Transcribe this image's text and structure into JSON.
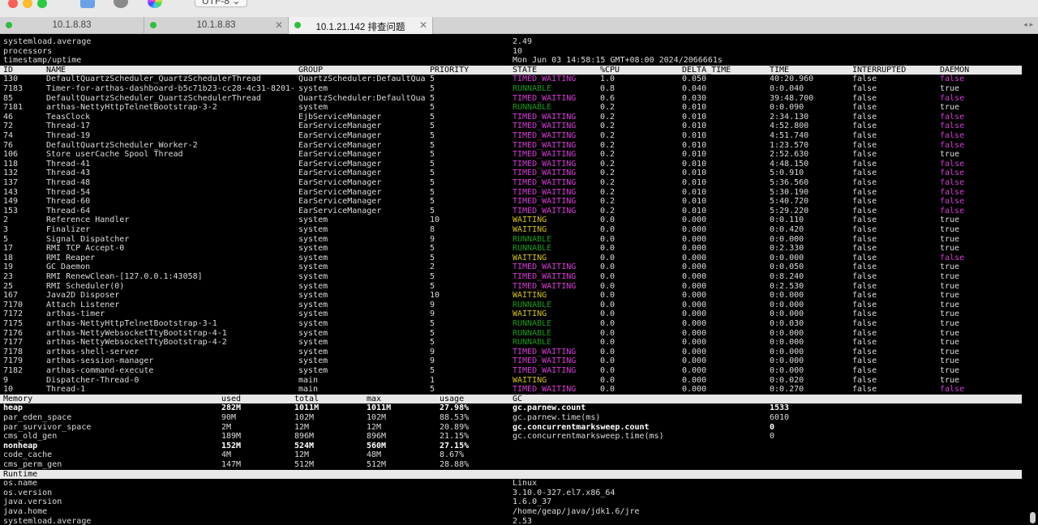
{
  "window": {
    "encoding": "UTF-8 ⌄",
    "traffic_lights": [
      "#fc5f57",
      "#fdbc2e",
      "#29c940"
    ],
    "tabs": [
      {
        "label": "10.1.8.83",
        "active": false
      },
      {
        "label": "10.1.8.83",
        "active": false
      },
      {
        "label": "10.1.21.142 排查问题",
        "active": true
      }
    ],
    "tab_close": "✕",
    "tab_nav": "◂ ▸"
  },
  "colors": {
    "timed_waiting": "#d63cd6",
    "waiting": "#d4c41c",
    "runnable": "#1f9a1f",
    "daemon_false": "#d63cd6"
  },
  "top_info": [
    {
      "key": "systemload.average",
      "value": "2.49"
    },
    {
      "key": "processors",
      "value": "10"
    },
    {
      "key": "timestamp/uptime",
      "value": "Mon Jun 03 14:58:15 GMT+08:00 2024/2066661s"
    }
  ],
  "threads": {
    "columns": [
      "ID",
      "NAME",
      "GROUP",
      "PRIORITY",
      "STATE",
      "%CPU",
      "DELTA_TIME",
      "TIME",
      "INTERRUPTED",
      "DAEMON"
    ],
    "rows": [
      [
        "130",
        "DefaultQuartzScheduler_QuartzSchedulerThread",
        "QuartzScheduler:DefaultQua",
        "5",
        "TIMED_WAITING",
        "1.0",
        "0.050",
        "40:20.960",
        "false",
        "false"
      ],
      [
        "7183",
        "Timer-for-arthas-dashboard-b5c71b23-cc28-4c31-8201-",
        "system",
        "5",
        "RUNNABLE",
        "0.8",
        "0.040",
        "0:0.040",
        "false",
        "true"
      ],
      [
        "85",
        "DefaultQuartzScheduler_QuartzSchedulerThread",
        "QuartzScheduler:DefaultQua",
        "5",
        "TIMED_WAITING",
        "0.6",
        "0.030",
        "39:48.700",
        "false",
        "false"
      ],
      [
        "7181",
        "arthas-NettyHttpTelnetBootstrap-3-2",
        "system",
        "5",
        "RUNNABLE",
        "0.2",
        "0.010",
        "0:0.090",
        "false",
        "true"
      ],
      [
        "46",
        "TeasClock",
        "EjbServiceManager",
        "5",
        "TIMED_WAITING",
        "0.2",
        "0.010",
        "2:34.130",
        "false",
        "false"
      ],
      [
        "72",
        "Thread-17",
        "EarServiceManager",
        "5",
        "TIMED_WAITING",
        "0.2",
        "0.010",
        "4:52.800",
        "false",
        "false"
      ],
      [
        "74",
        "Thread-19",
        "EarServiceManager",
        "5",
        "TIMED_WAITING",
        "0.2",
        "0.010",
        "4:51.740",
        "false",
        "false"
      ],
      [
        "76",
        "DefaultQuartzScheduler_Worker-2",
        "EarServiceManager",
        "5",
        "TIMED_WAITING",
        "0.2",
        "0.010",
        "1:23.570",
        "false",
        "false"
      ],
      [
        "106",
        "Store userCache Spool Thread",
        "EarServiceManager",
        "5",
        "TIMED_WAITING",
        "0.2",
        "0.010",
        "2:52.630",
        "false",
        "true"
      ],
      [
        "118",
        "Thread-41",
        "EarServiceManager",
        "5",
        "TIMED_WAITING",
        "0.2",
        "0.010",
        "4:48.150",
        "false",
        "false"
      ],
      [
        "132",
        "Thread-43",
        "EarServiceManager",
        "5",
        "TIMED_WAITING",
        "0.2",
        "0.010",
        "5:0.910",
        "false",
        "false"
      ],
      [
        "137",
        "Thread-48",
        "EarServiceManager",
        "5",
        "TIMED_WAITING",
        "0.2",
        "0.010",
        "5:36.560",
        "false",
        "false"
      ],
      [
        "143",
        "Thread-54",
        "EarServiceManager",
        "5",
        "TIMED_WAITING",
        "0.2",
        "0.010",
        "5:30.190",
        "false",
        "false"
      ],
      [
        "149",
        "Thread-60",
        "EarServiceManager",
        "5",
        "TIMED_WAITING",
        "0.2",
        "0.010",
        "5:40.720",
        "false",
        "false"
      ],
      [
        "153",
        "Thread-64",
        "EarServiceManager",
        "5",
        "TIMED_WAITING",
        "0.2",
        "0.010",
        "5:29.220",
        "false",
        "false"
      ],
      [
        "2",
        "Reference Handler",
        "system",
        "10",
        "WAITING",
        "0.0",
        "0.000",
        "0:0.110",
        "false",
        "true"
      ],
      [
        "3",
        "Finalizer",
        "system",
        "8",
        "WAITING",
        "0.0",
        "0.000",
        "0:0.420",
        "false",
        "true"
      ],
      [
        "5",
        "Signal Dispatcher",
        "system",
        "9",
        "RUNNABLE",
        "0.0",
        "0.000",
        "0:0.000",
        "false",
        "true"
      ],
      [
        "17",
        "RMI TCP Accept-0",
        "system",
        "5",
        "RUNNABLE",
        "0.0",
        "0.000",
        "0:2.330",
        "false",
        "true"
      ],
      [
        "18",
        "RMI Reaper",
        "system",
        "5",
        "WAITING",
        "0.0",
        "0.000",
        "0:0.000",
        "false",
        "false"
      ],
      [
        "19",
        "GC Daemon",
        "system",
        "2",
        "TIMED_WAITING",
        "0.0",
        "0.000",
        "0:0.050",
        "false",
        "true"
      ],
      [
        "23",
        "RMI RenewClean-[127.0.0.1:43058]",
        "system",
        "5",
        "TIMED_WAITING",
        "0.0",
        "0.000",
        "0:8.240",
        "false",
        "true"
      ],
      [
        "25",
        "RMI Scheduler(0)",
        "system",
        "5",
        "TIMED_WAITING",
        "0.0",
        "0.000",
        "0:2.530",
        "false",
        "true"
      ],
      [
        "167",
        "Java2D Disposer",
        "system",
        "10",
        "WAITING",
        "0.0",
        "0.000",
        "0:0.000",
        "false",
        "true"
      ],
      [
        "7170",
        "Attach Listener",
        "system",
        "9",
        "RUNNABLE",
        "0.0",
        "0.000",
        "0:0.000",
        "false",
        "true"
      ],
      [
        "7172",
        "arthas-timer",
        "system",
        "9",
        "WAITING",
        "0.0",
        "0.000",
        "0:0.000",
        "false",
        "true"
      ],
      [
        "7175",
        "arthas-NettyHttpTelnetBootstrap-3-1",
        "system",
        "5",
        "RUNNABLE",
        "0.0",
        "0.000",
        "0:0.030",
        "false",
        "true"
      ],
      [
        "7176",
        "arthas-NettyWebsocketTtyBootstrap-4-1",
        "system",
        "5",
        "RUNNABLE",
        "0.0",
        "0.000",
        "0:0.000",
        "false",
        "true"
      ],
      [
        "7177",
        "arthas-NettyWebsocketTtyBootstrap-4-2",
        "system",
        "5",
        "RUNNABLE",
        "0.0",
        "0.000",
        "0:0.000",
        "false",
        "true"
      ],
      [
        "7178",
        "arthas-shell-server",
        "system",
        "9",
        "TIMED_WAITING",
        "0.0",
        "0.000",
        "0:0.000",
        "false",
        "true"
      ],
      [
        "7179",
        "arthas-session-manager",
        "system",
        "9",
        "TIMED_WAITING",
        "0.0",
        "0.000",
        "0:0.000",
        "false",
        "true"
      ],
      [
        "7182",
        "arthas-command-execute",
        "system",
        "5",
        "TIMED_WAITING",
        "0.0",
        "0.000",
        "0:0.000",
        "false",
        "true"
      ],
      [
        "9",
        "Dispatcher-Thread-0",
        "main",
        "1",
        "WAITING",
        "0.0",
        "0.000",
        "0:0.020",
        "false",
        "true"
      ],
      [
        "10",
        "Thread-1",
        "main",
        "5",
        "TIMED_WAITING",
        "0.0",
        "0.000",
        "0:0.270",
        "false",
        "false"
      ]
    ]
  },
  "memory": {
    "columns": [
      "Memory",
      "used",
      "total",
      "max",
      "usage"
    ],
    "rows": [
      {
        "cells": [
          "heap",
          "282M",
          "1011M",
          "1011M",
          "27.98%"
        ],
        "bold": true
      },
      {
        "cells": [
          "par_eden_space",
          "90M",
          "102M",
          "102M",
          "88.53%"
        ],
        "bold": false
      },
      {
        "cells": [
          "par_survivor_space",
          "2M",
          "12M",
          "12M",
          "20.89%"
        ],
        "bold": false
      },
      {
        "cells": [
          "cms_old_gen",
          "189M",
          "896M",
          "896M",
          "21.15%"
        ],
        "bold": false
      },
      {
        "cells": [
          "nonheap",
          "152M",
          "524M",
          "560M",
          "27.15%"
        ],
        "bold": true
      },
      {
        "cells": [
          "code_cache",
          "4M",
          "12M",
          "48M",
          "8.67%"
        ],
        "bold": false
      },
      {
        "cells": [
          "cms_perm_gen",
          "147M",
          "512M",
          "512M",
          "28.88%"
        ],
        "bold": false
      }
    ]
  },
  "gc": {
    "title": "GC",
    "rows": [
      {
        "key": "gc.parnew.count",
        "value": "1533",
        "bold": true
      },
      {
        "key": "gc.parnew.time(ms)",
        "value": "6010",
        "bold": false
      },
      {
        "key": "gc.concurrentmarksweep.count",
        "value": "0",
        "bold": true
      },
      {
        "key": "gc.concurrentmarksweep.time(ms)",
        "value": "0",
        "bold": false
      }
    ]
  },
  "runtime": {
    "title": "Runtime",
    "rows": [
      {
        "key": "os.name",
        "value": "Linux"
      },
      {
        "key": "os.version",
        "value": "3.10.0-327.el7.x86_64"
      },
      {
        "key": "java.version",
        "value": "1.6.0_37"
      },
      {
        "key": "java.home",
        "value": "/home/geap/java/jdk1.6/jre"
      },
      {
        "key": "systemload.average",
        "value": "2.53"
      }
    ]
  }
}
